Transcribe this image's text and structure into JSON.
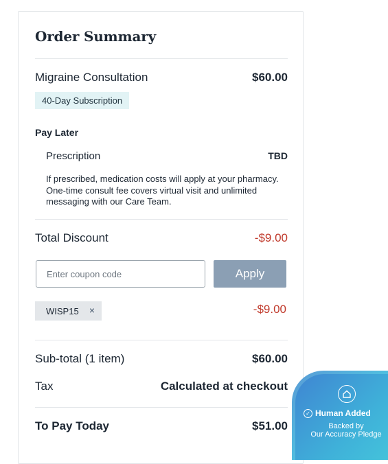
{
  "order": {
    "title": "Order Summary",
    "item": {
      "name": "Migraine Consultation",
      "price": "$60.00",
      "badge": "40-Day Subscription"
    },
    "pay_later": {
      "heading": "Pay Later",
      "prescription_label": "Prescription",
      "prescription_value": "TBD",
      "note": "If prescribed, medication costs will apply at your pharmacy. One-time consult fee covers virtual visit and unlimited messaging with our Care Team."
    },
    "discount": {
      "label": "Total Discount",
      "value": "-$9.00"
    },
    "coupon": {
      "placeholder": "Enter coupon code",
      "value": "",
      "apply_label": "Apply",
      "applied_code": "WISP15",
      "remove_icon": "×",
      "applied_amount": "-$9.00"
    },
    "subtotal": {
      "label": "Sub-total (1 item)",
      "value": "$60.00"
    },
    "tax": {
      "label": "Tax",
      "value": "Calculated at checkout"
    },
    "total": {
      "label": "To Pay Today",
      "value": "$51.00"
    }
  },
  "pledge": {
    "icon": "house-shield-icon",
    "check_icon": "check-circle-icon",
    "headline": "Human Added",
    "line1": "Backed by",
    "line2": "Our Accuracy Pledge"
  },
  "colors": {
    "negative": "#c0392b",
    "badge_bg": "#e2f3f5",
    "apply_button": "#8b9fb4",
    "pledge_gradient_start": "#3f86d2",
    "pledge_gradient_end": "#45c6db"
  }
}
